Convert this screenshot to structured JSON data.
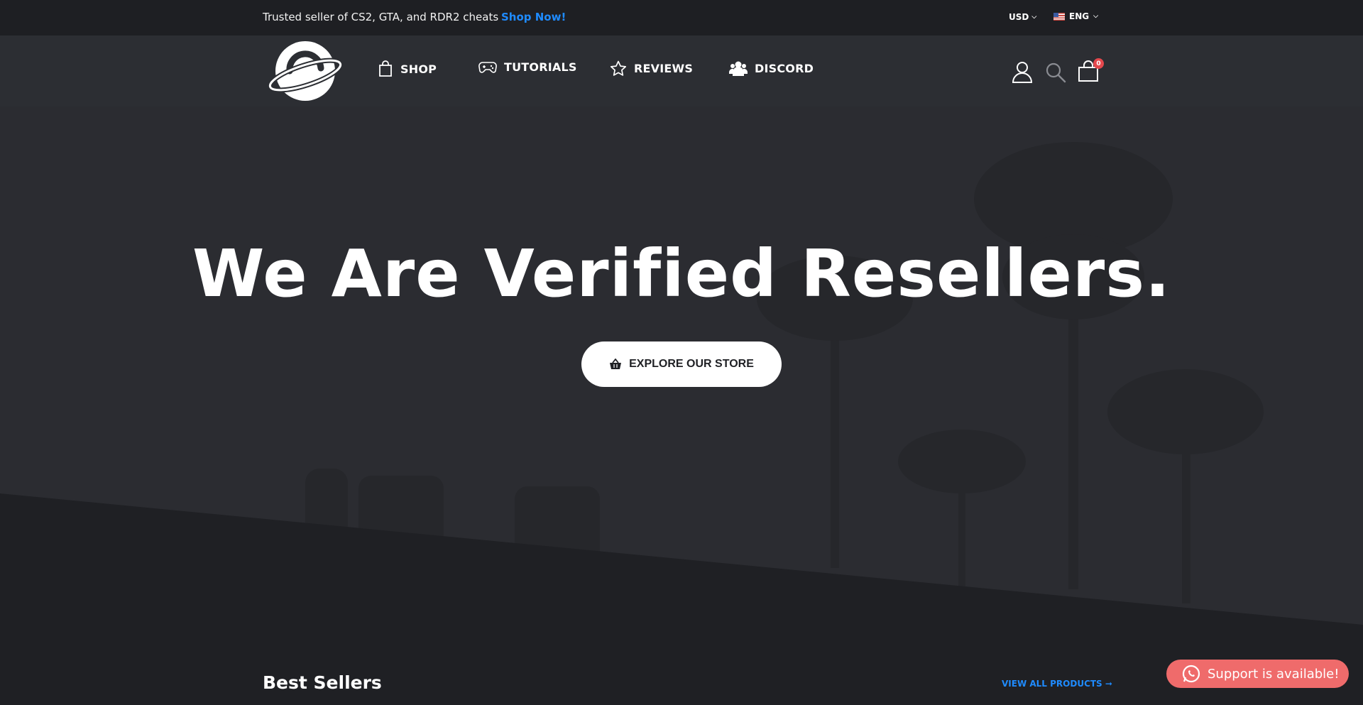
{
  "topbar": {
    "promo_text": "Trusted seller of CS2, GTA, and RDR2 cheats",
    "shop_now": "Shop Now!",
    "currency": "USD",
    "language": "ENG"
  },
  "nav": {
    "shop": "SHOP",
    "tutorials": "TUTORIALS",
    "reviews": "REVIEWS",
    "discord": "DISCORD"
  },
  "cart": {
    "count": "0"
  },
  "hero": {
    "title": "We Are Verified Resellers.",
    "cta": "EXPLORE OUR STORE"
  },
  "section": {
    "best_sellers": "Best Sellers",
    "view_all": "VIEW ALL PRODUCTS ➞"
  },
  "support": {
    "label": "Support is available!"
  },
  "colors": {
    "accent": "#1f8bff",
    "badge": "#e5484d",
    "support": "#ef6b6b",
    "background": "#1f2024"
  }
}
